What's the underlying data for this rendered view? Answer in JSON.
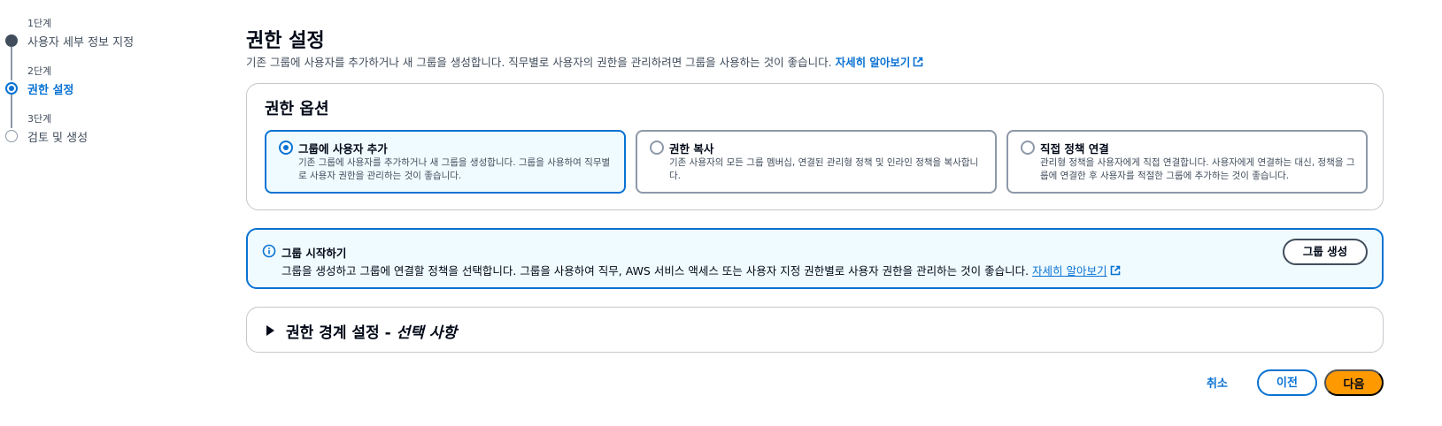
{
  "steps": [
    {
      "number": "1단계",
      "title": "사용자 세부 정보 지정",
      "state": "done"
    },
    {
      "number": "2단계",
      "title": "권한 설정",
      "state": "current"
    },
    {
      "number": "3단계",
      "title": "검토 및 생성",
      "state": "pending"
    }
  ],
  "page": {
    "title": "권한 설정",
    "description": "기존 그룹에 사용자를 추가하거나 새 그룹을 생성합니다. 직무별로 사용자의 권한을 관리하려면 그룹을 사용하는 것이 좋습니다.",
    "learn_more": "자세히 알아보기"
  },
  "options_card": {
    "title": "권한 옵션",
    "options": [
      {
        "label": "그룹에 사용자 추가",
        "description": "기존 그룹에 사용자를 추가하거나 새 그룹을 생성합니다. 그룹을 사용하여 직무별로 사용자 권한을 관리하는 것이 좋습니다.",
        "selected": true
      },
      {
        "label": "권한 복사",
        "description": "기존 사용자의 모든 그룹 멤버십, 연결된 관리형 정책 및 인라인 정책을 복사합니다.",
        "selected": false
      },
      {
        "label": "직접 정책 연결",
        "description": "관리형 정책을 사용자에게 직접 연결합니다. 사용자에게 연결하는 대신, 정책을 그룹에 연결한 후 사용자를 적절한 그룹에 추가하는 것이 좋습니다.",
        "selected": false
      }
    ]
  },
  "info_alert": {
    "title": "그룹 시작하기",
    "description": "그룹을 생성하고 그룹에 연결할 정책을 선택합니다. 그룹을 사용하여 직무, AWS 서비스 액세스 또는 사용자 지정 권한별로 사용자 권한을 관리하는 것이 좋습니다.",
    "learn_more": "자세히 알아보기",
    "button": "그룹 생성"
  },
  "boundary": {
    "title": "권한 경계 설정 -",
    "optional": "선택 사항"
  },
  "footer": {
    "cancel": "취소",
    "previous": "이전",
    "next": "다음"
  },
  "colors": {
    "accent": "#0972d3",
    "primary_button": "#ff9900",
    "text": "#000716"
  }
}
